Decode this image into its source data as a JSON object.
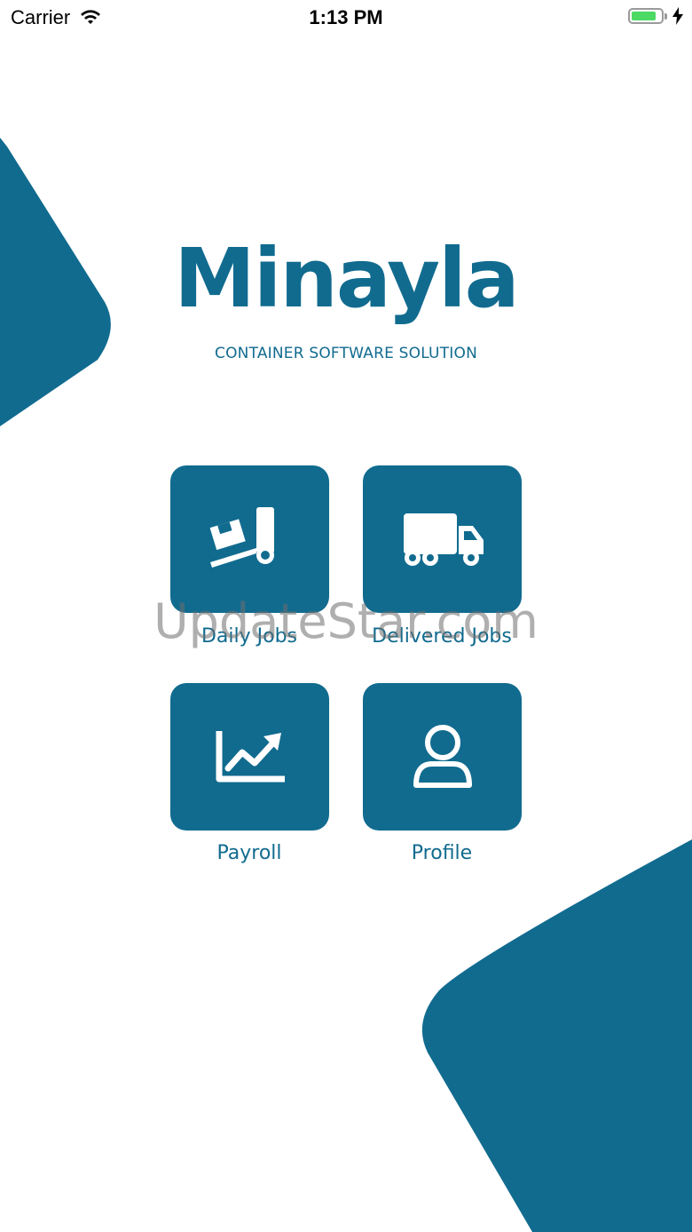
{
  "status_bar": {
    "carrier": "Carrier",
    "time": "1:13 PM",
    "battery_level": 0.85
  },
  "branding": {
    "logo_text": "Minayla",
    "tagline": "CONTAINER SOFTWARE SOLUTION"
  },
  "menu": {
    "daily_jobs": "Daily Jobs",
    "delivered_jobs": "Delivered Jobs",
    "payroll": "Payroll",
    "profile": "Profile"
  },
  "watermark": "UpdateStar.com",
  "colors": {
    "accent": "#116b8f",
    "battery": "#4cd964"
  }
}
